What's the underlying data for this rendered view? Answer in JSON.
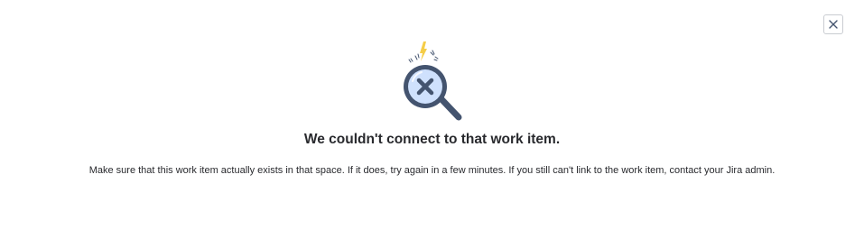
{
  "dialog": {
    "close_icon": "close-icon",
    "illustration_icon": "search-error-magnifier-icon",
    "heading": "We couldn't connect to that work item.",
    "message": "Make sure that this work item actually exists in that space. If it does, try again in a few minutes. If you still can't link to the work item, contact your Jira admin."
  },
  "colors": {
    "magnifier_rim": "#44546f",
    "lens_fill": "#cfe1fd",
    "lightning": "#f5cd47",
    "text": "#292a2e",
    "border": "#c9ccd1"
  }
}
